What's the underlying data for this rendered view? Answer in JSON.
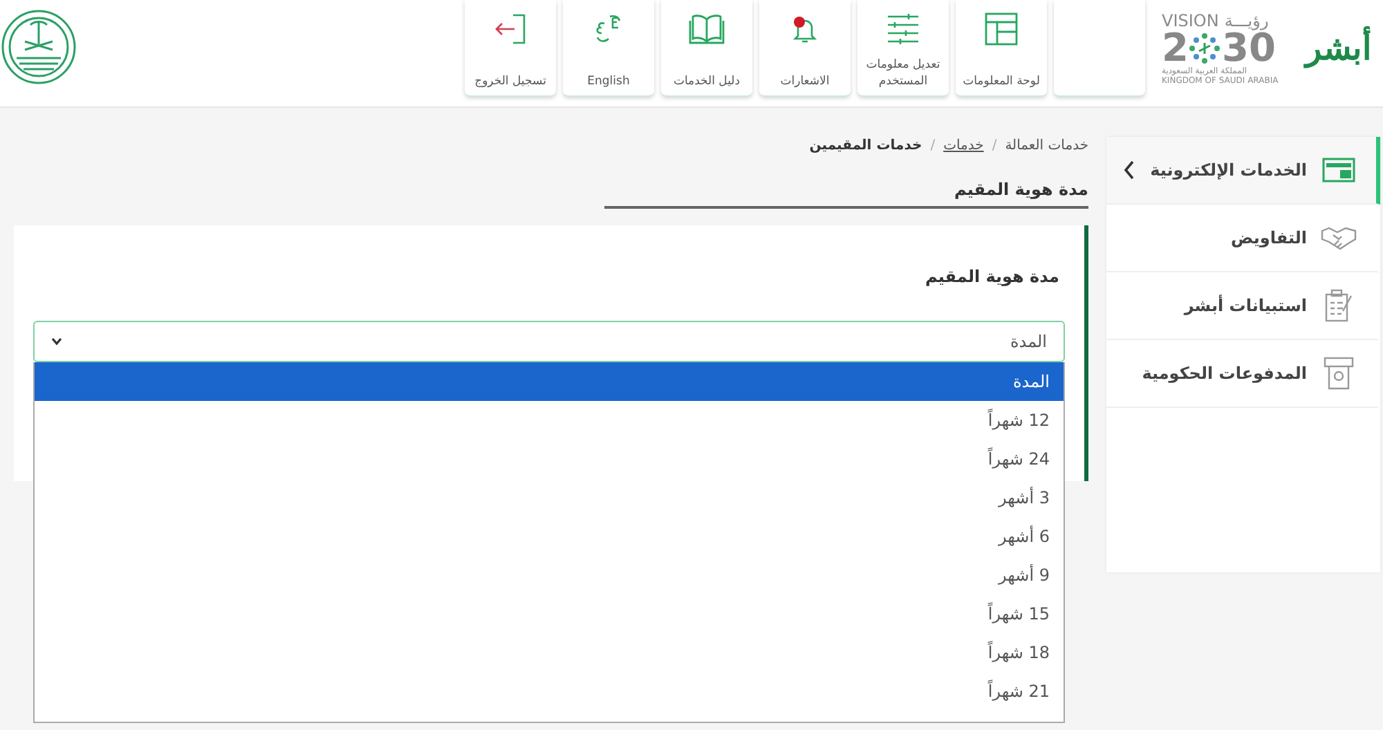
{
  "header": {
    "brand": "أبشر",
    "vision_logo": {
      "word_ar": "رؤيـــة",
      "word_en": "VISION",
      "year_start": "2",
      "year_end": "30",
      "country_ar": "المملكة العربية السعودية",
      "country_en": "KINGDOM OF SAUDI ARABIA"
    },
    "tiles": [
      {
        "kind": "blank"
      },
      {
        "kind": "nav",
        "label": "لوحة المعلومات"
      },
      {
        "kind": "nav",
        "label": "تعديل معلومات المستخدم"
      },
      {
        "kind": "nav",
        "label": "الاشعارات"
      },
      {
        "kind": "nav",
        "label": "دليل الخدمات"
      },
      {
        "kind": "nav",
        "label": "English"
      },
      {
        "kind": "nav",
        "label": "تسجيل الخروج"
      }
    ]
  },
  "sidebar": {
    "items": [
      {
        "label": "الخدمات الإلكترونية",
        "selected": true
      },
      {
        "label": "التفاويض",
        "selected": false
      },
      {
        "label": "استبيانات أبشر",
        "selected": false
      },
      {
        "label": "المدفوعات الحكومية",
        "selected": false
      }
    ]
  },
  "breadcrumb": [
    {
      "label": "خدمات العمالة",
      "kind": "text"
    },
    {
      "label": "/",
      "kind": "separator"
    },
    {
      "label": "خدمات",
      "kind": "link"
    },
    {
      "label": "/",
      "kind": "separator"
    },
    {
      "label": "خدمات المقيمين",
      "kind": "current"
    }
  ],
  "page_title": "مدة هوية المقيم",
  "form": {
    "label": "مدة هوية المقيم",
    "select": {
      "value": "المدة",
      "expanded": true,
      "options": [
        {
          "label": "المدة",
          "selected": true
        },
        {
          "label": "12 شهراً",
          "selected": false
        },
        {
          "label": "24 شهراً",
          "selected": false
        },
        {
          "label": "3 أشهر",
          "selected": false
        },
        {
          "label": "6 أشهر",
          "selected": false
        },
        {
          "label": "9 أشهر",
          "selected": false
        },
        {
          "label": "15 شهراً",
          "selected": false
        },
        {
          "label": "18 شهراً",
          "selected": false
        },
        {
          "label": "21 شهراً",
          "selected": false
        }
      ]
    }
  }
}
